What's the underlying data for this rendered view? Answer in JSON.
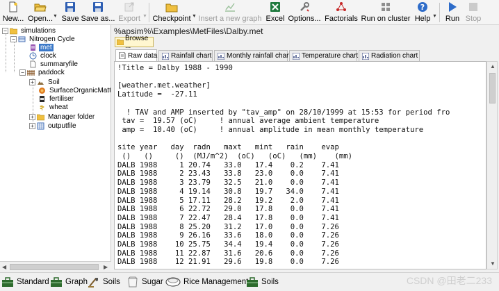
{
  "toolbar": {
    "new": "New...",
    "open": "Open...",
    "save": "Save",
    "save_as": "Save as...",
    "export": "Export",
    "checkpoint": "Checkpoint",
    "insert_graph": "Insert a new graph",
    "excel": "Excel",
    "options": "Options...",
    "factorials": "Factorials",
    "run_on_cluster": "Run on cluster",
    "help": "Help",
    "run": "Run",
    "stop": "Stop"
  },
  "tree": {
    "simulations": "simulations",
    "nitrogen_cycle": "Nitrogen Cycle",
    "met": "met",
    "clock": "clock",
    "summaryfile": "summaryfile",
    "paddock": "paddock",
    "soil": "Soil",
    "surface_om": "SurfaceOrganicMatte",
    "fertiliser": "fertiliser",
    "wheat": "wheat",
    "manager_folder": "Manager folder",
    "outputfile": "outputfile"
  },
  "file_path": "%apsim%\\Examples\\MetFiles\\Dalby.met",
  "browse_label": "Browse ...",
  "tabs": [
    "Raw data",
    "Rainfall chart",
    "Monthly rainfall chart",
    "Temperature chart",
    "Radiation chart"
  ],
  "raw_data_text": "!Title = Dalby 1988 - 1990\n\n[weather.met.weather]\nLatitude =  -27.11\n\n  ! TAV and AMP inserted by \"tav_amp\" on 28/10/1999 at 15:53 for period fro\n tav =  19.57 (oC)     ! annual average ambient temperature\n amp =  10.40 (oC)     ! annual amplitude in mean monthly temperature\n\nsite year   day  radn   maxt   mint   rain    evap\n ()   ()     ()  (MJ/m^2)  (oC)   (oC)   (mm)    (mm)\nDALB 1988     1 20.74   33.0   17.4    0.2    7.41\nDALB 1988     2 23.43   33.8   23.0    0.0    7.41\nDALB 1988     3 23.79   32.5   21.0    0.0    7.41\nDALB 1988     4 19.14   30.8   19.7   34.0    7.41\nDALB 1988     5 17.11   28.2   19.2    2.0    7.41\nDALB 1988     6 22.72   29.0   17.8    0.0    7.41\nDALB 1988     7 22.47   28.4   17.8    0.0    7.41\nDALB 1988     8 25.20   31.2   17.0    0.0    7.26\nDALB 1988     9 26.16   33.6   18.0    0.0    7.26\nDALB 1988    10 25.75   34.4   19.4    0.0    7.26\nDALB 1988    11 22.87   31.6   20.6    0.0    7.26\nDALB 1988    12 21.91   29.6   19.8    0.0    7.26",
  "bottom_tabs": [
    "Standard",
    "Graph",
    "Soils",
    "Sugar",
    "Rice Management",
    "Soils"
  ],
  "watermark": "CSDN @田老二233"
}
